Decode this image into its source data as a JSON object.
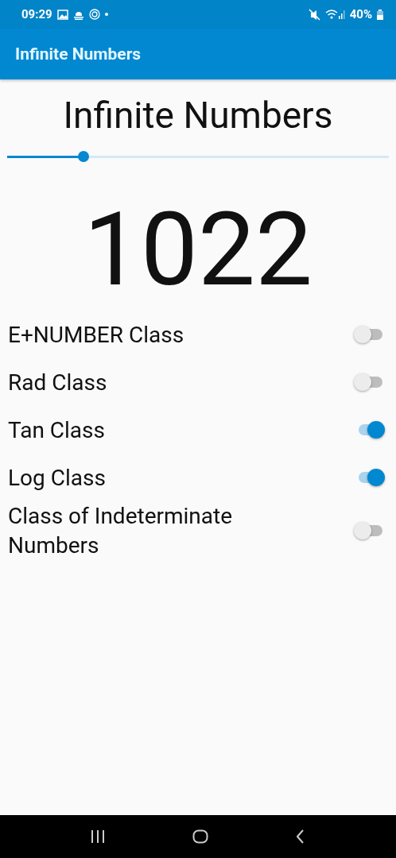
{
  "status_bar": {
    "time": "09:29",
    "battery": "40%"
  },
  "app_bar": {
    "title": "Infinite Numbers"
  },
  "heading": "Infinite Numbers",
  "slider": {
    "level": 0.2
  },
  "number": "1022",
  "options": [
    {
      "label": "E+NUMBER Class",
      "on": false
    },
    {
      "label": "Rad Class",
      "on": false
    },
    {
      "label": "Tan Class",
      "on": true
    },
    {
      "label": "Log Class",
      "on": true
    },
    {
      "label": "Class of Indeterminate Numbers",
      "on": false
    }
  ]
}
